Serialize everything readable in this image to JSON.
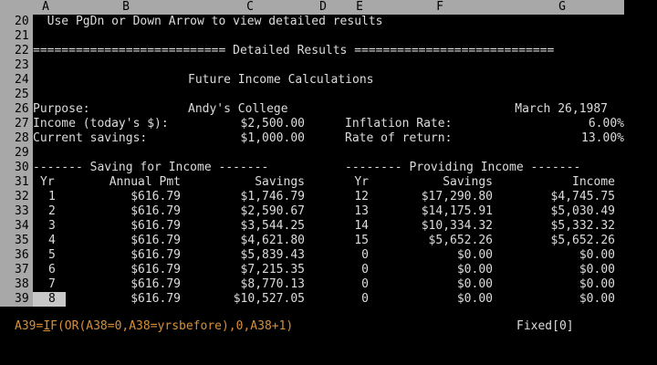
{
  "columns": [
    "A",
    "B",
    "C",
    "D",
    "E",
    "F",
    "G"
  ],
  "rows": {
    "r20": {
      "num": "20",
      "text": "  Use PgDn or Down Arrow to view detailed results"
    },
    "r21": {
      "num": "21"
    },
    "r22": {
      "num": "22",
      "text": "=========================== Detailed Results ============================"
    },
    "r23": {
      "num": "23"
    },
    "r24": {
      "num": "24",
      "text": "Future Income Calculations"
    },
    "r25": {
      "num": "25"
    },
    "r26": {
      "num": "26",
      "purpose_label": "Purpose:",
      "purpose_value": "Andy's College",
      "date": "March 26,1987"
    },
    "r27": {
      "num": "27",
      "income_label": "Income (today's $):",
      "income_value": "$2,500.00",
      "inflation_label": "Inflation Rate:",
      "inflation_value": "6.00%"
    },
    "r28": {
      "num": "28",
      "savings_label": "Current savings:",
      "savings_value": "$1,000.00",
      "return_label": "Rate of return:",
      "return_value": "13.00%"
    },
    "r29": {
      "num": "29"
    },
    "r30": {
      "num": "30",
      "left": "------- Saving for Income -------",
      "right": "-------- Providing Income -------"
    },
    "r31": {
      "num": "31",
      "h1": "Yr",
      "h2": "Annual Pmt",
      "h3": "Savings",
      "h4": "Yr",
      "h5": "Savings",
      "h6": "Income"
    }
  },
  "table": [
    {
      "num": "32",
      "yr": "1",
      "pmt": "$616.79",
      "sav": "$1,746.79",
      "yr2": "12",
      "sav2": "$17,290.80",
      "inc": "$4,745.75"
    },
    {
      "num": "33",
      "yr": "2",
      "pmt": "$616.79",
      "sav": "$2,590.67",
      "yr2": "13",
      "sav2": "$14,175.91",
      "inc": "$5,030.49"
    },
    {
      "num": "34",
      "yr": "3",
      "pmt": "$616.79",
      "sav": "$3,544.25",
      "yr2": "14",
      "sav2": "$10,334.32",
      "inc": "$5,332.32"
    },
    {
      "num": "35",
      "yr": "4",
      "pmt": "$616.79",
      "sav": "$4,621.80",
      "yr2": "15",
      "sav2": "$5,652.26",
      "inc": "$5,652.26"
    },
    {
      "num": "36",
      "yr": "5",
      "pmt": "$616.79",
      "sav": "$5,839.43",
      "yr2": "0",
      "sav2": "$0.00",
      "inc": "$0.00"
    },
    {
      "num": "37",
      "yr": "6",
      "pmt": "$616.79",
      "sav": "$7,215.35",
      "yr2": "0",
      "sav2": "$0.00",
      "inc": "$0.00"
    },
    {
      "num": "38",
      "yr": "7",
      "pmt": "$616.79",
      "sav": "$8,770.13",
      "yr2": "0",
      "sav2": "$0.00",
      "inc": "$0.00"
    },
    {
      "num": "39",
      "yr": "8",
      "pmt": "$616.79",
      "sav": "$10,527.05",
      "yr2": "0",
      "sav2": "$0.00",
      "inc": "$0.00"
    }
  ],
  "status": {
    "cell_ref": "A39=",
    "func_first": "I",
    "formula_rest": "F(OR(A38=0,A38=yrsbefore),0,A38+1)",
    "format": "Fixed[0]"
  },
  "colors": {
    "background": "#000000",
    "header_gray": "#a8a8a8",
    "text": "#dcdcdc",
    "status_orange": "#d89038"
  }
}
